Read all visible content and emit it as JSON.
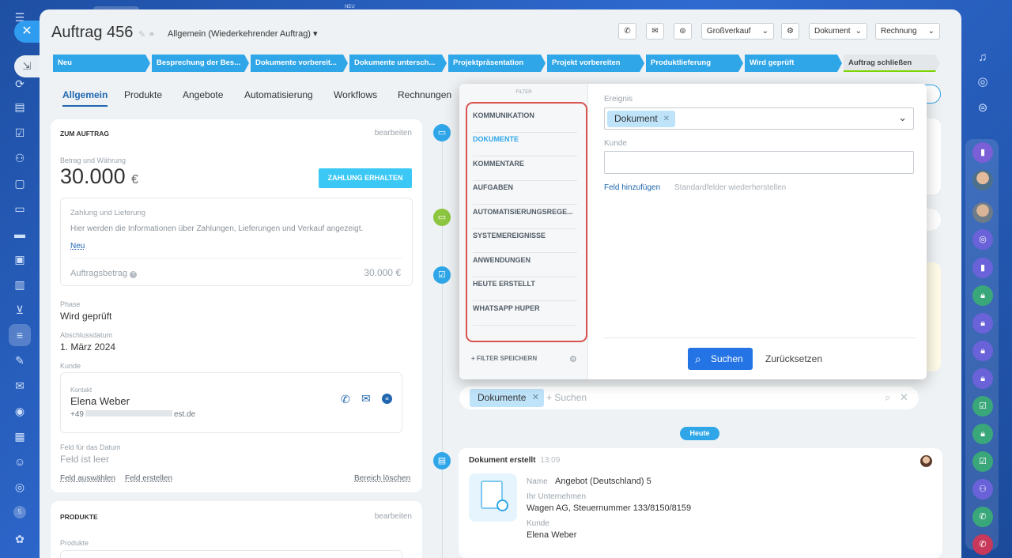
{
  "order": {
    "title": "Auftrag 456",
    "subtitle": "Allgemein (Wiederkehrender Auftrag)"
  },
  "header_buttons": {
    "grossverkauf": "Großverkauf",
    "dokument": "Dokument",
    "rechnung": "Rechnung"
  },
  "stages": [
    "Neu",
    "Besprechung der Bes...",
    "Dokumente vorbereit...",
    "Dokumente untersch...",
    "Projektpräsentation",
    "Projekt vorbereiten",
    "Produktlieferung",
    "Wird geprüft",
    "Auftrag schließen"
  ],
  "tabs": [
    "Allgemein",
    "Produkte",
    "Angebote",
    "Automatisierung",
    "Workflows",
    "Rechnungen"
  ],
  "order_card": {
    "section_title": "ZUM AUFTRAG",
    "edit": "bearbeiten",
    "amount_label": "Betrag und Währung",
    "amount": "30.000",
    "currency": "€",
    "pay_button": "ZAHLUNG ERHALTEN",
    "payment_title": "Zahlung und Lieferung",
    "payment_info": "Hier werden die Informationen über Zahlungen, Lieferungen und Verkauf angezeigt.",
    "payment_new": "Neu",
    "order_amount_label": "Auftragsbetrag",
    "order_amount_value": "30.000 €",
    "phase_label": "Phase",
    "phase_value": "Wird geprüft",
    "close_date_label": "Abschlussdatum",
    "close_date_value": "1. März 2024",
    "client_label": "Kunde",
    "contact_label": "Kontakt",
    "contact_name": "Elena Weber",
    "contact_phone": "+49",
    "contact_email_tail": "est.de",
    "date_field_label": "Feld für das Datum",
    "date_field_value": "Feld ist leer",
    "select_field": "Feld auswählen",
    "create_field": "Feld erstellen",
    "delete_section": "Bereich löschen"
  },
  "products_card": {
    "section_title": "PRODUKTE",
    "edit": "bearbeiten",
    "products_label": "Produkte"
  },
  "filter": {
    "header": "FILTER",
    "items": [
      "KOMMUNIKATION",
      "DOKUMENTE",
      "KOMMENTARE",
      "AUFGABEN",
      "AUTOMATISIERUNGSREGE...",
      "SYSTEMEREIGNISSE",
      "ANWENDUNGEN",
      "HEUTE ERSTELLT",
      "WHATSAPP HUPER"
    ],
    "save_filter": "FILTER SPEICHERN",
    "event_label": "Ereignis",
    "event_chip": "Dokument",
    "client_label": "Kunde",
    "add_field": "Feld hinzufügen",
    "restore_fields": "Standardfelder wiederherstellen",
    "search_button": "Suchen",
    "reset_button": "Zurücksetzen"
  },
  "timeline": {
    "search_chip": "Dokumente",
    "search_placeholder": "+ Suchen",
    "today": "Heute",
    "doc_title": "Dokument erstellt",
    "doc_time": "13:09",
    "name_label": "Name",
    "name_value": "Angebot (Deutschland) 5",
    "company_label": "Ihr Unternehmen",
    "company_value": "Wagen AG, Steuernummer 133/8150/8159",
    "client_label": "Kunde",
    "client_value": "Elena Weber"
  },
  "top_hint": "NEU",
  "counter_badge": "5",
  "colors": {
    "accent": "#2fa6e8",
    "primary_button": "#2474e5",
    "highlight": "#d9534f",
    "stage_done": "#2fa6e8",
    "success": "#7bd500"
  }
}
